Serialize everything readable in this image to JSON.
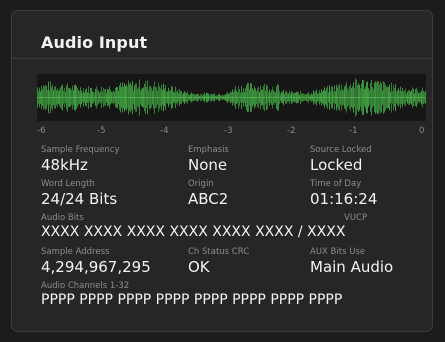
{
  "panel": {
    "title": "Audio Input"
  },
  "meter": {
    "scale": [
      "-6",
      "-5",
      "-4",
      "-3",
      "-2",
      "-1",
      "0"
    ],
    "waveform_color": "#3f9a3f"
  },
  "fields": {
    "sample_frequency": {
      "label": "Sample Frequency",
      "value": "48kHz"
    },
    "emphasis": {
      "label": "Emphasis",
      "value": "None"
    },
    "source_locked": {
      "label": "Source Locked",
      "value": "Locked"
    },
    "word_length": {
      "label": "Word Length",
      "value": "24/24 Bits"
    },
    "origin": {
      "label": "Origin",
      "value": "ABC2"
    },
    "time_of_day": {
      "label": "Time of Day",
      "value": "01:16:24"
    },
    "audio_bits": {
      "label": "Audio Bits",
      "label_right": "VUCP",
      "value": "XXXX XXXX XXXX XXXX XXXX XXXX / XXXX"
    },
    "sample_address": {
      "label": "Sample Address",
      "value": "4,294,967,295"
    },
    "ch_status_crc": {
      "label": "Ch Status CRC",
      "value": "OK"
    },
    "aux_bits_use": {
      "label": "AUX Bits Use",
      "value": "Main Audio"
    },
    "audio_channels": {
      "label": "Audio Channels 1-32",
      "value": "PPPP PPPP PPPP PPPP PPPP PPPP PPPP PPPP"
    }
  }
}
